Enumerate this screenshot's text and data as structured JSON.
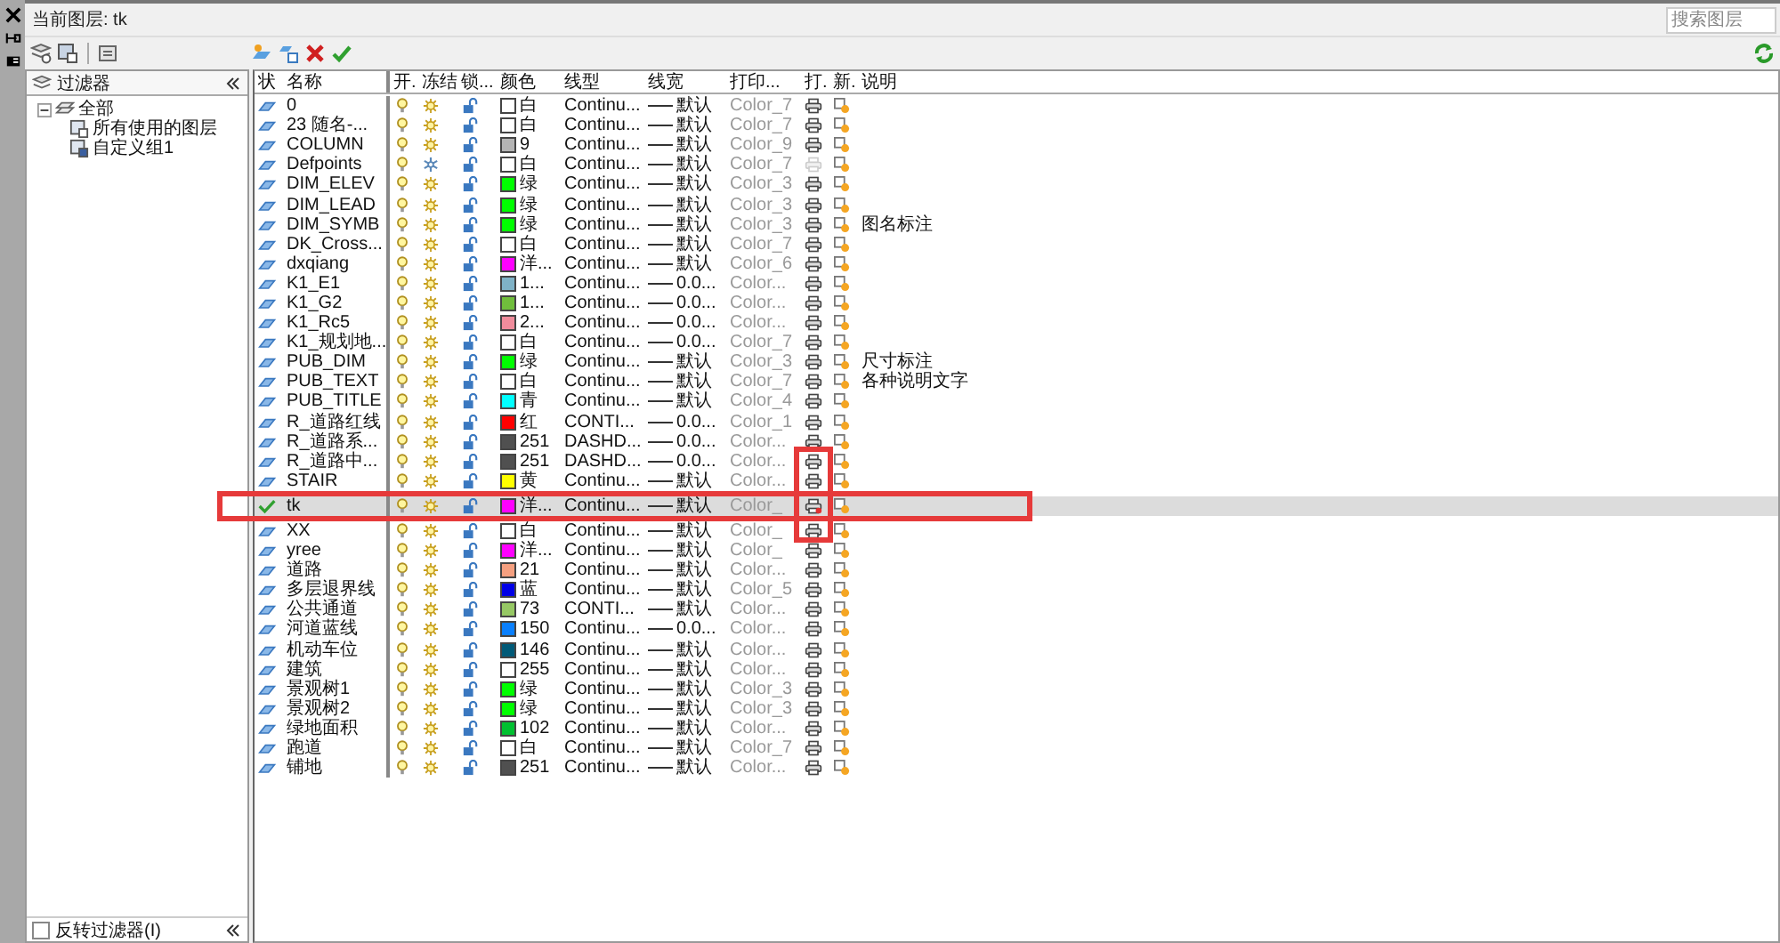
{
  "current_layer": {
    "label": "当前图层:",
    "value": "tk"
  },
  "search": {
    "placeholder": "搜索图层"
  },
  "filters": {
    "title": "过滤器",
    "tree": [
      {
        "label": "全部",
        "expanded": true,
        "children": [
          {
            "label": "所有使用的图层"
          },
          {
            "label": "自定义组1"
          }
        ]
      }
    ],
    "invert": {
      "label": "反转过滤器(I)",
      "checked": false
    }
  },
  "table": {
    "columns": [
      "状",
      "名称",
      "开.",
      "冻结",
      "锁...",
      "颜色",
      "线型",
      "线宽",
      "打印...",
      "打.",
      "新.",
      "说明"
    ],
    "rows": [
      {
        "current": false,
        "name": "0",
        "frozen": false,
        "color": "#ffffff",
        "color_name": "白",
        "linetype": "Continu...",
        "lineweight": "默认",
        "plot_style": "Color_7",
        "plot": true
      },
      {
        "current": false,
        "name": "23 随名-...",
        "frozen": false,
        "color": "#ffffff",
        "color_name": "白",
        "linetype": "Continu...",
        "lineweight": "默认",
        "plot_style": "Color_7",
        "plot": true
      },
      {
        "current": false,
        "name": "COLUMN",
        "frozen": false,
        "color": "#b4b4b4",
        "color_name": "9",
        "linetype": "Continu...",
        "lineweight": "默认",
        "plot_style": "Color_9",
        "plot": true
      },
      {
        "current": false,
        "name": "Defpoints",
        "frozen": true,
        "color": "#ffffff",
        "color_name": "白",
        "linetype": "Continu...",
        "lineweight": "默认",
        "plot_style": "Color_7",
        "plot": false
      },
      {
        "current": false,
        "name": "DIM_ELEV",
        "frozen": false,
        "color": "#00ff00",
        "color_name": "绿",
        "linetype": "Continu...",
        "lineweight": "默认",
        "plot_style": "Color_3",
        "plot": true
      },
      {
        "current": false,
        "name": "DIM_LEAD",
        "frozen": false,
        "color": "#00ff00",
        "color_name": "绿",
        "linetype": "Continu...",
        "lineweight": "默认",
        "plot_style": "Color_3",
        "plot": true
      },
      {
        "current": false,
        "name": "DIM_SYMB",
        "frozen": false,
        "color": "#00ff00",
        "color_name": "绿",
        "linetype": "Continu...",
        "lineweight": "默认",
        "plot_style": "Color_3",
        "plot": true,
        "description": "图名标注"
      },
      {
        "current": false,
        "name": "DK_Cross...",
        "frozen": false,
        "color": "#ffffff",
        "color_name": "白",
        "linetype": "Continu...",
        "lineweight": "默认",
        "plot_style": "Color_7",
        "plot": true
      },
      {
        "current": false,
        "name": "dxqiang",
        "frozen": false,
        "color": "#ff00ff",
        "color_name": "洋...",
        "linetype": "Continu...",
        "lineweight": "默认",
        "plot_style": "Color_6",
        "plot": true
      },
      {
        "current": false,
        "name": "K1_E1",
        "frozen": false,
        "color": "#7fb2c6",
        "color_name": "1...",
        "linetype": "Continu...",
        "lineweight": "0.0...",
        "plot_style": "Color...",
        "plot": true
      },
      {
        "current": false,
        "name": "K1_G2",
        "frozen": false,
        "color": "#70be3c",
        "color_name": "1...",
        "linetype": "Continu...",
        "lineweight": "0.0...",
        "plot_style": "Color...",
        "plot": true
      },
      {
        "current": false,
        "name": "K1_Rc5",
        "frozen": false,
        "color": "#f08c9c",
        "color_name": "2...",
        "linetype": "Continu...",
        "lineweight": "0.0...",
        "plot_style": "Color...",
        "plot": true
      },
      {
        "current": false,
        "name": "K1_规划地...",
        "frozen": false,
        "color": "#ffffff",
        "color_name": "白",
        "linetype": "Continu...",
        "lineweight": "0.0...",
        "plot_style": "Color_7",
        "plot": true
      },
      {
        "current": false,
        "name": "PUB_DIM",
        "frozen": false,
        "color": "#00ff00",
        "color_name": "绿",
        "linetype": "Continu...",
        "lineweight": "默认",
        "plot_style": "Color_3",
        "plot": true,
        "description": "尺寸标注"
      },
      {
        "current": false,
        "name": "PUB_TEXT",
        "frozen": false,
        "color": "#ffffff",
        "color_name": "白",
        "linetype": "Continu...",
        "lineweight": "默认",
        "plot_style": "Color_7",
        "plot": true,
        "description": "各种说明文字"
      },
      {
        "current": false,
        "name": "PUB_TITLE",
        "frozen": false,
        "color": "#00ffff",
        "color_name": "青",
        "linetype": "Continu...",
        "lineweight": "默认",
        "plot_style": "Color_4",
        "plot": true
      },
      {
        "current": false,
        "name": "R_道路红线",
        "frozen": false,
        "color": "#ff0000",
        "color_name": "红",
        "linetype": "CONTI...",
        "lineweight": "0.0...",
        "plot_style": "Color_1",
        "plot": true
      },
      {
        "current": false,
        "name": "R_道路系...",
        "frozen": false,
        "color": "#505050",
        "color_name": "251",
        "linetype": "DASHD...",
        "lineweight": "0.0...",
        "plot_style": "Color...",
        "plot": true
      },
      {
        "current": false,
        "name": "R_道路中...",
        "frozen": false,
        "color": "#505050",
        "color_name": "251",
        "linetype": "DASHD...",
        "lineweight": "0.0...",
        "plot_style": "Color...",
        "plot": true
      },
      {
        "current": false,
        "name": "STAIR",
        "frozen": false,
        "color": "#ffff00",
        "color_name": "黄",
        "linetype": "Continu...",
        "lineweight": "默认",
        "plot_style": "Color...",
        "plot": true
      },
      {
        "current": true,
        "name": "tk",
        "frozen": false,
        "color": "#ff00ff",
        "color_name": "洋...",
        "linetype": "Continu...",
        "lineweight": "默认",
        "plot_style": "Color_",
        "plot": true
      },
      {
        "current": false,
        "name": "XX",
        "frozen": false,
        "color": "#ffffff",
        "color_name": "白",
        "linetype": "Continu...",
        "lineweight": "默认",
        "plot_style": "Color_",
        "plot": true
      },
      {
        "current": false,
        "name": "yree",
        "frozen": false,
        "color": "#ff00ff",
        "color_name": "洋...",
        "linetype": "Continu...",
        "lineweight": "默认",
        "plot_style": "Color_",
        "plot": true
      },
      {
        "current": false,
        "name": "道路",
        "frozen": false,
        "color": "#f5a080",
        "color_name": "21",
        "linetype": "Continu...",
        "lineweight": "默认",
        "plot_style": "Color...",
        "plot": true
      },
      {
        "current": false,
        "name": "多层退界线",
        "frozen": false,
        "color": "#0000e6",
        "color_name": "蓝",
        "linetype": "Continu...",
        "lineweight": "默认",
        "plot_style": "Color_5",
        "plot": true
      },
      {
        "current": false,
        "name": "公共通道",
        "frozen": false,
        "color": "#96c864",
        "color_name": "73",
        "linetype": "CONTI...",
        "lineweight": "默认",
        "plot_style": "Color...",
        "plot": true
      },
      {
        "current": false,
        "name": "河道蓝线",
        "frozen": false,
        "color": "#0a80ff",
        "color_name": "150",
        "linetype": "Continu...",
        "lineweight": "0.0...",
        "plot_style": "Color...",
        "plot": true
      },
      {
        "current": false,
        "name": "机动车位",
        "frozen": false,
        "color": "#005a78",
        "color_name": "146",
        "linetype": "Continu...",
        "lineweight": "默认",
        "plot_style": "Color...",
        "plot": true
      },
      {
        "current": false,
        "name": "建筑",
        "frozen": false,
        "color": "#ffffff",
        "color_name": "255",
        "linetype": "Continu...",
        "lineweight": "默认",
        "plot_style": "Color...",
        "plot": true
      },
      {
        "current": false,
        "name": "景观树1",
        "frozen": false,
        "color": "#00ff00",
        "color_name": "绿",
        "linetype": "Continu...",
        "lineweight": "默认",
        "plot_style": "Color_3",
        "plot": true
      },
      {
        "current": false,
        "name": "景观树2",
        "frozen": false,
        "color": "#00ff00",
        "color_name": "绿",
        "linetype": "Continu...",
        "lineweight": "默认",
        "plot_style": "Color_3",
        "plot": true
      },
      {
        "current": false,
        "name": "绿地面积",
        "frozen": false,
        "color": "#00c030",
        "color_name": "102",
        "linetype": "Continu...",
        "lineweight": "默认",
        "plot_style": "Color...",
        "plot": true
      },
      {
        "current": false,
        "name": "跑道",
        "frozen": false,
        "color": "#ffffff",
        "color_name": "白",
        "linetype": "Continu...",
        "lineweight": "默认",
        "plot_style": "Color_7",
        "plot": true
      },
      {
        "current": false,
        "name": "铺地",
        "frozen": false,
        "color": "#505050",
        "color_name": "251",
        "linetype": "Continu...",
        "lineweight": "默认",
        "plot_style": "Color...",
        "plot": true
      }
    ]
  }
}
